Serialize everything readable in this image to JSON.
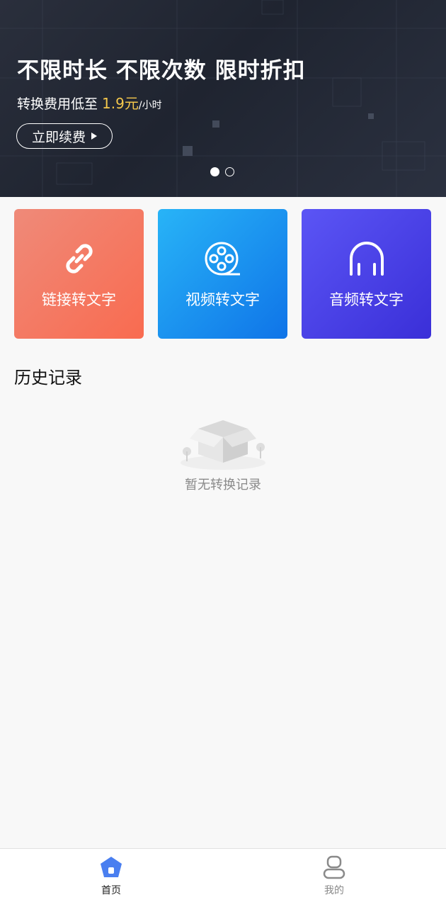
{
  "banner": {
    "title": "不限时长 不限次数 限时折扣",
    "subtitle_prefix": "转换费用低至 ",
    "price": "1.9元",
    "unit": "/小时",
    "button_label": "立即续费",
    "carousel_total": 2,
    "carousel_active": 1,
    "background_color": "#1f2430"
  },
  "features": [
    {
      "label": "链接转文字",
      "icon": "link-icon",
      "color_start": "#ef8a79",
      "color_end": "#f96b50"
    },
    {
      "label": "视频转文字",
      "icon": "film-reel-icon",
      "color_start": "#28b4f7",
      "color_end": "#0f74e8"
    },
    {
      "label": "音频转文字",
      "icon": "headphones-icon",
      "color_start": "#5b55f5",
      "color_end": "#3a2fd8"
    }
  ],
  "history": {
    "title": "历史记录",
    "empty_text": "暂无转换记录"
  },
  "tabbar": {
    "home_label": "首页",
    "mine_label": "我的",
    "active": "首页",
    "accent_color": "#4a7ff0"
  }
}
